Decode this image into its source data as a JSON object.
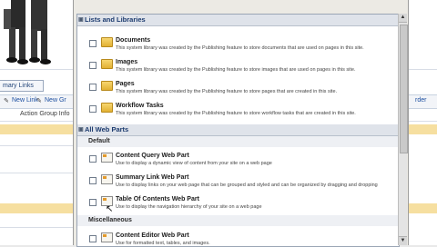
{
  "background": {
    "tab_label": "mary Links",
    "new_link": "New Link",
    "new_group": "New Gr",
    "action_group": "Action Group Info",
    "right_label": "rder"
  },
  "picker": {
    "sections": [
      {
        "title": "Lists and Libraries",
        "items": [
          {
            "title": "Documents",
            "desc": "This system library was created by the Publishing feature to store documents that are used on pages in this site.",
            "icon": "library-icon"
          },
          {
            "title": "Images",
            "desc": "This system library was created by the Publishing feature to store images that are used on pages in this site.",
            "icon": "library-icon"
          },
          {
            "title": "Pages",
            "desc": "This system library was created by the Publishing feature to store pages that are created in this site.",
            "icon": "library-icon"
          },
          {
            "title": "Workflow Tasks",
            "desc": "This system library was created by the Publishing feature to store workflow tasks that are created in this site.",
            "icon": "library-icon"
          }
        ]
      },
      {
        "title": "All Web Parts",
        "groups": [
          {
            "name": "Default",
            "items": [
              {
                "title": "Content Query Web Part",
                "desc": "Use to display a dynamic view of content from your site on a web page",
                "icon": "web-part-icon"
              },
              {
                "title": "Summary Link Web Part",
                "desc": "Use to display links on your web page that can be grouped and styled and can be organized by dragging and dropping",
                "icon": "web-part-icon"
              },
              {
                "title": "Table Of Contents Web Part",
                "desc": "Use to display the navigation hierarchy of your site on a web page",
                "icon": "web-part-icon"
              }
            ]
          },
          {
            "name": "Miscellaneous",
            "items": [
              {
                "title": "Content Editor Web Part",
                "desc": "Use for formatted text, tables, and images.",
                "icon": "web-part-icon"
              }
            ]
          }
        ]
      }
    ]
  },
  "scrollbar": {
    "up": "▲",
    "down": "▼"
  }
}
